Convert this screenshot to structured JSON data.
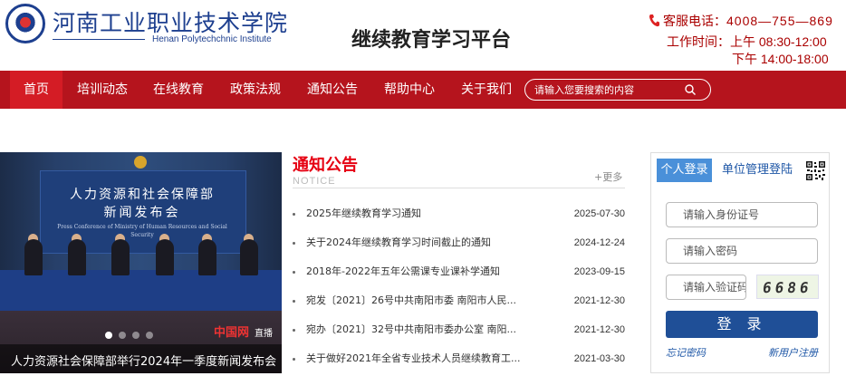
{
  "header": {
    "logo_cn": "河南工业职业技术学院",
    "logo_en": "Henan Polytechchnic Institute",
    "platform_title": "继续教育学习平台",
    "service_label": "客服电话：",
    "service_phone": "4008—755—869",
    "worktime_label": "工作时间：上午 08:30-12:00",
    "worktime_pm": "下午 14:00-18:00"
  },
  "nav": {
    "items": [
      {
        "label": "首页",
        "active": true
      },
      {
        "label": "培训动态"
      },
      {
        "label": "在线教育"
      },
      {
        "label": "政策法规"
      },
      {
        "label": "通知公告"
      },
      {
        "label": "帮助中心"
      },
      {
        "label": "关于我们"
      }
    ],
    "search_placeholder": "请输入您要搜索的内容"
  },
  "banner": {
    "screen_title1": "人力资源和社会保障部",
    "screen_title2": "新闻发布会",
    "screen_sub": "Press Conference of Ministry of Human Resources and Social Security",
    "watermark": "中国网",
    "watermark_live": "直播",
    "caption": "人力资源社会保障部举行2024年一季度新闻发布会"
  },
  "notices": {
    "title": "通知公告",
    "title_en": "NOTICE",
    "more": "+更多",
    "items": [
      {
        "title": "2025年继续教育学习通知",
        "date": "2025-07-30"
      },
      {
        "title": "关于2024年继续教育学习时间截止的通知",
        "date": "2024-12-24"
      },
      {
        "title": "2018年-2022年五年公需课专业课补学通知",
        "date": "2023-09-15"
      },
      {
        "title": "宛发〔2021〕26号中共南阳市委 南阳市人民...",
        "date": "2021-12-30"
      },
      {
        "title": "宛办〔2021〕32号中共南阳市委办公室 南阳...",
        "date": "2021-12-30"
      },
      {
        "title": "关于做好2021年全省专业技术人员继续教育工...",
        "date": "2021-03-30"
      }
    ]
  },
  "login": {
    "tab_personal": "个人登录",
    "tab_unit": "单位管理登陆",
    "id_placeholder": "请输入身份证号",
    "password_placeholder": "请输入密码",
    "captcha_placeholder": "请输入验证码",
    "captcha_text": "6686",
    "submit": "登 录",
    "forgot": "忘记密码",
    "register": "新用户注册"
  },
  "colors": {
    "nav_bg": "#b5141d",
    "nav_active": "#d41c25",
    "accent_red": "#e60012",
    "login_button": "#1f4f97",
    "tab_blue": "#4a90d9"
  }
}
